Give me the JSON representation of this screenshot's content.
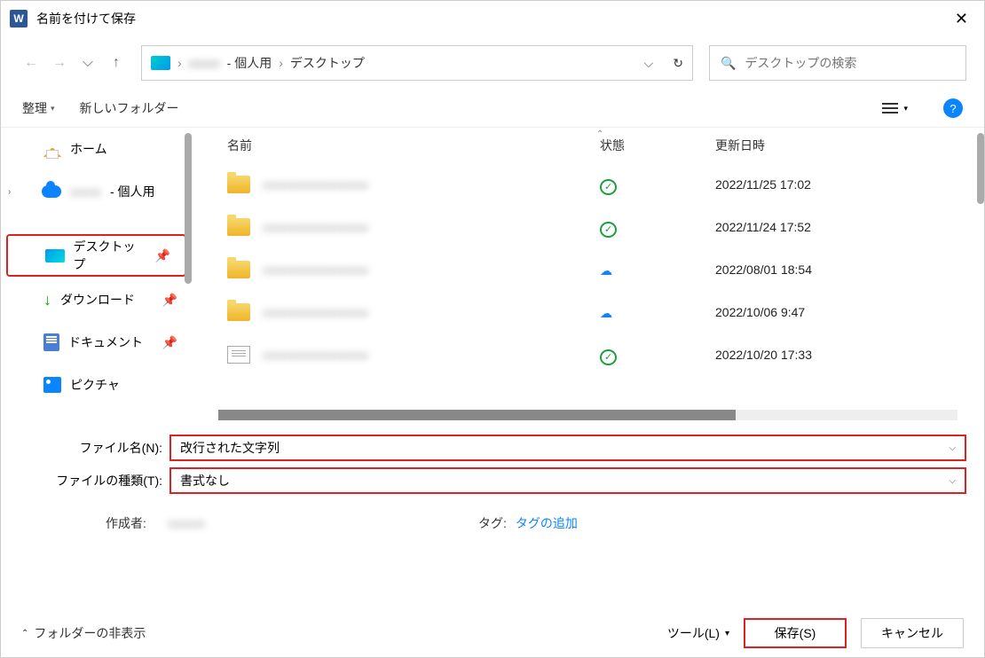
{
  "title": "名前を付けて保存",
  "breadcrumb": {
    "user_suffix": "- 個人用",
    "location": "デスクトップ"
  },
  "search_placeholder": "デスクトップの検索",
  "toolbar": {
    "organize": "整理",
    "new_folder": "新しいフォルダー"
  },
  "columns": {
    "name": "名前",
    "state": "状態",
    "modified": "更新日時"
  },
  "sidebar": {
    "home": "ホーム",
    "onedrive_suffix": " - 個人用",
    "desktop": "デスクトップ",
    "downloads": "ダウンロード",
    "documents": "ドキュメント",
    "pictures": "ピクチャ"
  },
  "files": [
    {
      "date": "2022/11/25 17:02",
      "state": "sync"
    },
    {
      "date": "2022/11/24 17:52",
      "state": "sync"
    },
    {
      "date": "2022/08/01 18:54",
      "state": "cloud"
    },
    {
      "date": "2022/10/06 9:47",
      "state": "cloud"
    },
    {
      "date": "2022/10/20 17:33",
      "state": "sync"
    }
  ],
  "fields": {
    "filename_label": "ファイル名(N):",
    "filename_value": "改行された文字列",
    "filetype_label": "ファイルの種類(T):",
    "filetype_value": "書式なし"
  },
  "meta": {
    "author_label": "作成者:",
    "tag_label": "タグ:",
    "tag_link": "タグの追加"
  },
  "footer": {
    "hide_folders": "フォルダーの非表示",
    "tools": "ツール(L)",
    "save": "保存(S)",
    "cancel": "キャンセル"
  }
}
